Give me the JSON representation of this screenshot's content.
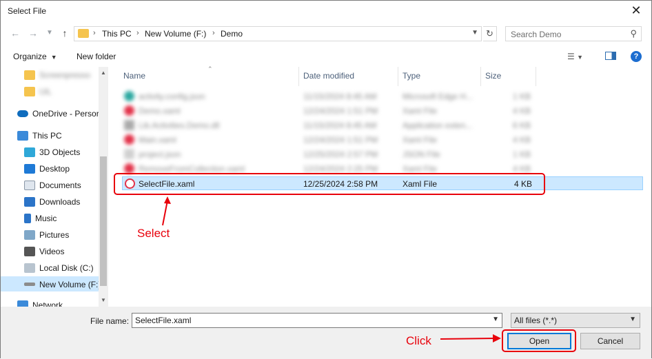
{
  "window": {
    "title": "Select File",
    "close_glyph": "✕"
  },
  "nav": {
    "breadcrumbs": [
      "This PC",
      "New Volume (F:)",
      "Demo"
    ],
    "search_placeholder": "Search Demo"
  },
  "toolbar": {
    "organize": "Organize",
    "new_folder": "New folder"
  },
  "sidebar": {
    "items": [
      {
        "label": "Screenpresso",
        "icon": "folder-icon",
        "blurred": true
      },
      {
        "label": "UiL",
        "icon": "folder-icon",
        "blurred": true
      },
      {
        "label": "OneDrive - Persor",
        "icon": "onedrive-icon"
      },
      {
        "label": "This PC",
        "icon": "this-pc-icon"
      },
      {
        "label": "3D Objects",
        "icon": "3d-objects-icon"
      },
      {
        "label": "Desktop",
        "icon": "desktop-icon"
      },
      {
        "label": "Documents",
        "icon": "documents-icon"
      },
      {
        "label": "Downloads",
        "icon": "downloads-icon"
      },
      {
        "label": "Music",
        "icon": "music-icon"
      },
      {
        "label": "Pictures",
        "icon": "pictures-icon"
      },
      {
        "label": "Videos",
        "icon": "videos-icon"
      },
      {
        "label": "Local Disk (C:)",
        "icon": "local-disk-icon"
      },
      {
        "label": "New Volume (F:)",
        "icon": "drive-icon",
        "selected": true
      },
      {
        "label": "Network",
        "icon": "network-icon"
      }
    ]
  },
  "columns": {
    "name": "Name",
    "date": "Date modified",
    "type": "Type",
    "size": "Size"
  },
  "files": [
    {
      "name": "activity.config.json",
      "date": "11/15/2024 8:45 AM",
      "type": "Microsoft Edge H...",
      "size": "1 KB",
      "icon": "edge-icon",
      "blurred": true
    },
    {
      "name": "Demo.xaml",
      "date": "12/24/2024 1:51 PM",
      "type": "Xaml File",
      "size": "4 KB",
      "icon": "xaml-icon",
      "blurred": true
    },
    {
      "name": "Lib.Activities.Demo.dll",
      "date": "11/15/2024 8:45 AM",
      "type": "Application exten...",
      "size": "6 KB",
      "icon": "dll-icon",
      "blurred": true
    },
    {
      "name": "Main.xaml",
      "date": "12/24/2024 1:51 PM",
      "type": "Xaml File",
      "size": "4 KB",
      "icon": "xaml-icon",
      "blurred": true
    },
    {
      "name": "project.json",
      "date": "12/25/2024 2:57 PM",
      "type": "JSON File",
      "size": "1 KB",
      "icon": "json-icon",
      "blurred": true
    },
    {
      "name": "RemoveFromCollection.xaml",
      "date": "12/24/2024 2:25 PM",
      "type": "Xaml File",
      "size": "4 KB",
      "icon": "xaml-icon",
      "blurred": true
    },
    {
      "name": "SelectFile.xaml",
      "date": "12/25/2024 2:58 PM",
      "type": "Xaml File",
      "size": "4 KB",
      "icon": "xaml-icon",
      "selected": true
    }
  ],
  "footer": {
    "file_name_label": "File name:",
    "file_name_value": "SelectFile.xaml",
    "filter_value": "All files (*.*)",
    "open_label": "Open",
    "cancel_label": "Cancel"
  },
  "annotations": {
    "select": "Select",
    "click": "Click"
  },
  "colors": {
    "accent": "#0078d7",
    "selection": "#cce8ff",
    "annotation_red": "#e8000b"
  }
}
